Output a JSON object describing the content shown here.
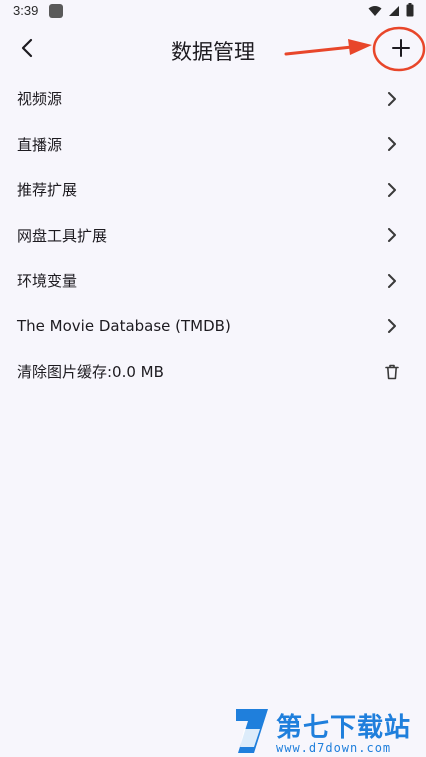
{
  "status_bar": {
    "time": "3:39",
    "icons": [
      "app-notification-icon",
      "wifi-icon",
      "signal-icon",
      "battery-icon"
    ]
  },
  "app_bar": {
    "title": "数据管理",
    "back_icon": "back-arrow-icon",
    "add_icon": "plus-icon"
  },
  "annotation": {
    "color": "#e8462a"
  },
  "list": {
    "items": [
      {
        "label": "视频源",
        "trailing": "chevron-right-icon"
      },
      {
        "label": "直播源",
        "trailing": "chevron-right-icon"
      },
      {
        "label": "推荐扩展",
        "trailing": "chevron-right-icon"
      },
      {
        "label": "网盘工具扩展",
        "trailing": "chevron-right-icon"
      },
      {
        "label": "环境变量",
        "trailing": "chevron-right-icon"
      },
      {
        "label": "The Movie Database (TMDB)",
        "trailing": "chevron-right-icon"
      },
      {
        "label": "清除图片缓存:0.0 MB",
        "trailing": "trash-icon"
      }
    ]
  },
  "watermark": {
    "title": "第七下载站",
    "url": "www.d7down.com",
    "color": "#1f7fdc"
  }
}
